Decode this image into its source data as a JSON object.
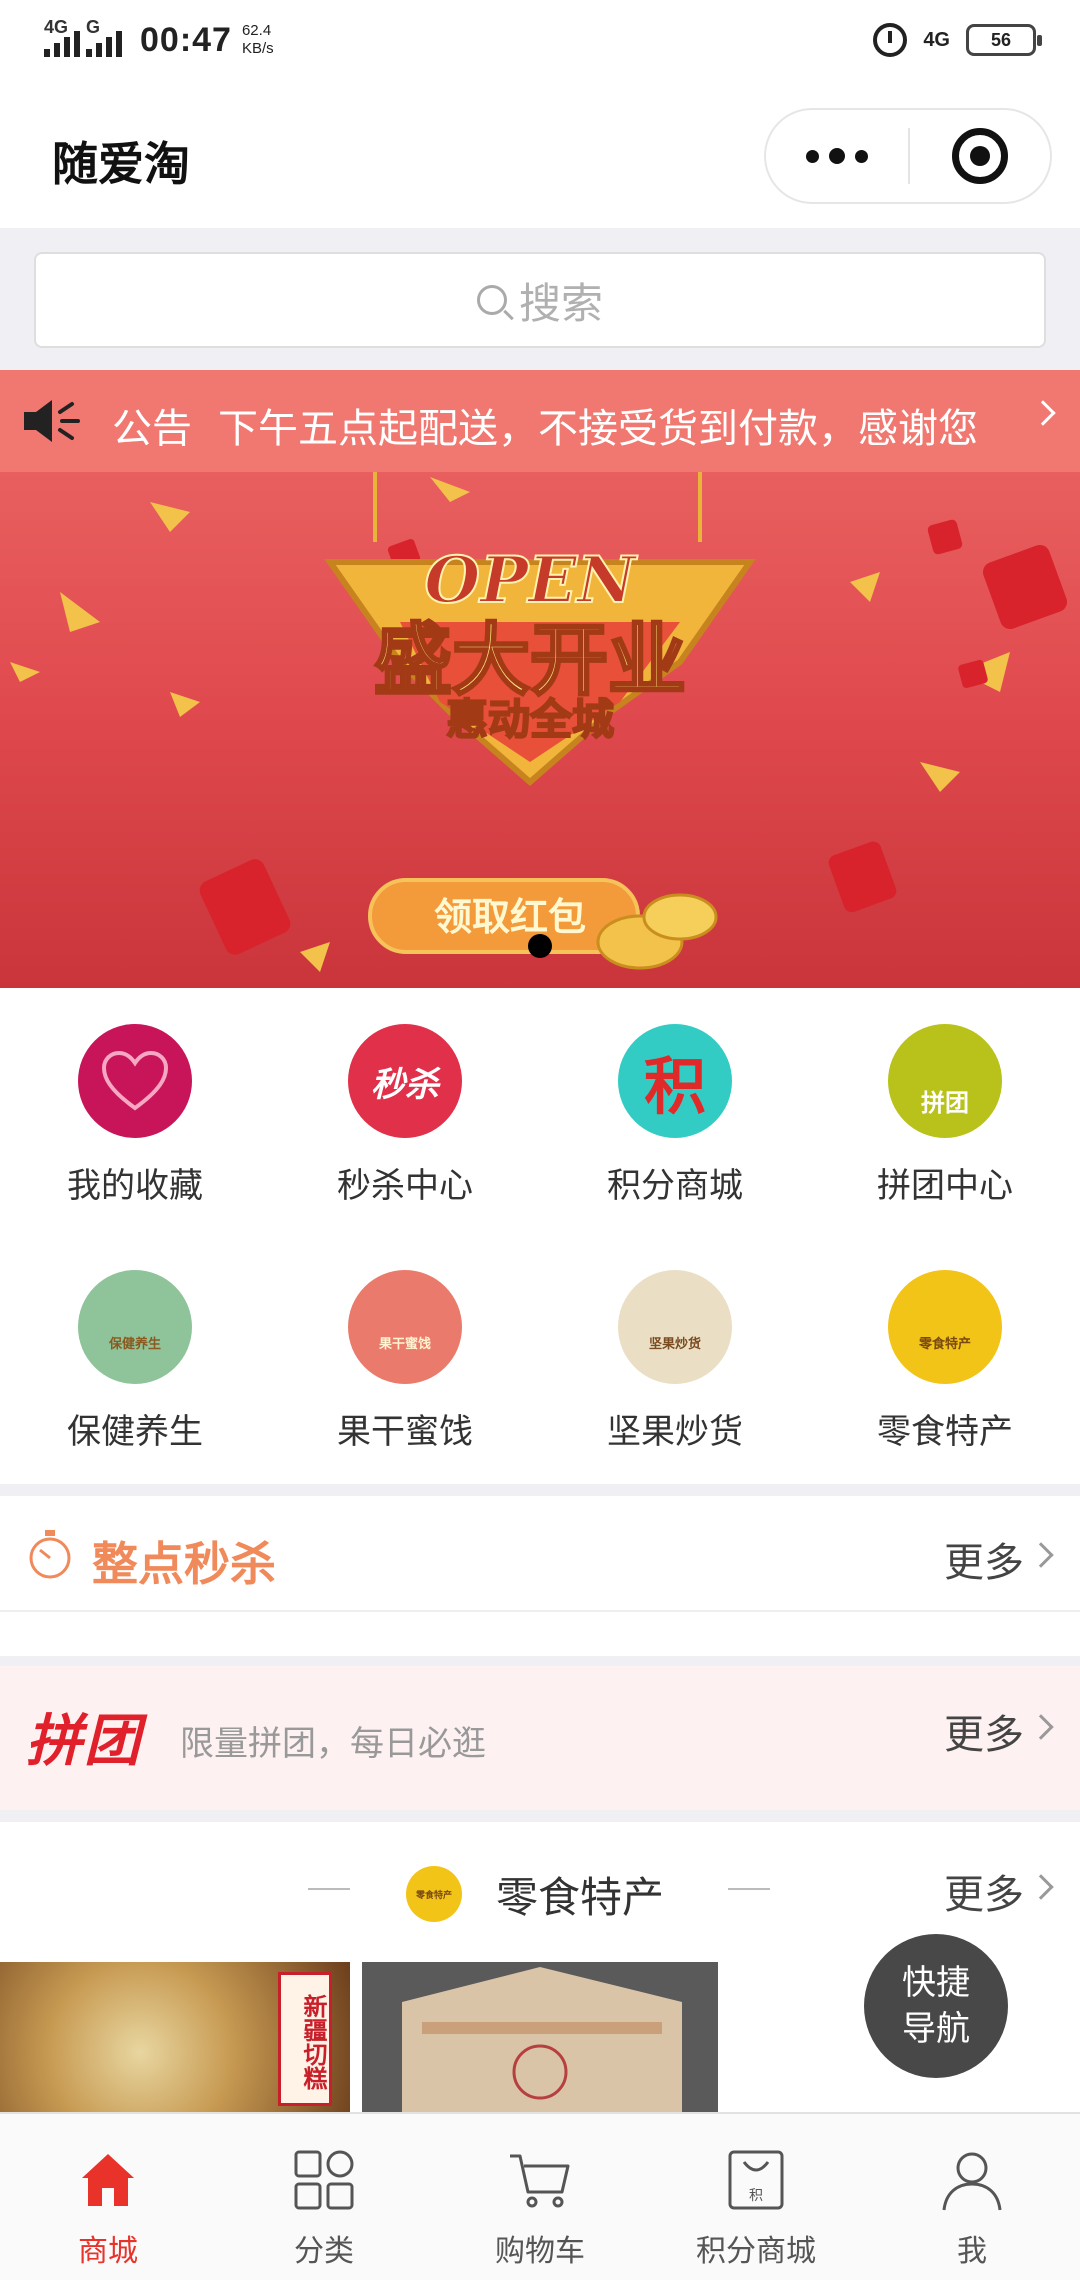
{
  "status_bar": {
    "net_left_1": "4G",
    "net_left_2": "G",
    "time": "00:47",
    "speed_value": "62.4",
    "speed_unit": "KB/s",
    "net_right": "4G",
    "battery": "56"
  },
  "header": {
    "title": "随爱淘"
  },
  "search": {
    "placeholder": "搜索"
  },
  "notice": {
    "label": "公告",
    "text": "下午五点起配送，不接受货到付款，感谢您"
  },
  "banner": {
    "headline": "OPEN",
    "title": "盛大开业",
    "subtitle": "惠动全城",
    "button": "领取红包",
    "slide_count": 1,
    "active_slide": 0
  },
  "grid": {
    "items": [
      {
        "label": "我的收藏",
        "icon": "heart-icon",
        "color": "#c8155a",
        "glyph": "♡"
      },
      {
        "label": "秒杀中心",
        "icon": "flash-sale-icon",
        "color": "#e0304a",
        "glyph": "秒杀"
      },
      {
        "label": "积分商城",
        "icon": "points-icon",
        "color": "#33ccc4",
        "glyph": "积"
      },
      {
        "label": "拼团中心",
        "icon": "group-buy-icon",
        "color": "#b8c21a",
        "glyph": "拼团"
      },
      {
        "label": "保健养生",
        "icon": "health-icon",
        "color": "#8fc49a",
        "glyph": "保健养生"
      },
      {
        "label": "果干蜜饯",
        "icon": "dried-fruit-icon",
        "color": "#ea7b6c",
        "glyph": "果干蜜饯"
      },
      {
        "label": "坚果炒货",
        "icon": "nuts-icon",
        "color": "#eadfc4",
        "glyph": "坚果炒货"
      },
      {
        "label": "零食特产",
        "icon": "snacks-icon",
        "color": "#f2c418",
        "glyph": "零食特产"
      }
    ]
  },
  "flash_sale": {
    "title": "整点秒杀",
    "more": "更多"
  },
  "group_buy": {
    "logo": "拼团",
    "tagline": "限量拼团，每日必逛",
    "more": "更多"
  },
  "snacks": {
    "title": "零食特产",
    "icon_text": "零食特产",
    "more": "更多",
    "product_1_tag": "新疆切糕"
  },
  "fab": {
    "line1": "快捷",
    "line2": "导航"
  },
  "tabbar": {
    "items": [
      {
        "label": "商城",
        "icon": "home-icon",
        "active": true
      },
      {
        "label": "分类",
        "icon": "category-icon",
        "active": false
      },
      {
        "label": "购物车",
        "icon": "cart-icon",
        "active": false
      },
      {
        "label": "积分商城",
        "icon": "points-bag-icon",
        "active": false
      },
      {
        "label": "我",
        "icon": "user-icon",
        "active": false
      }
    ]
  },
  "colors": {
    "accent": "#e8322a",
    "notice_bg": "#f07870",
    "flash_title": "#f08a5a",
    "page_bg": "#efeff4"
  }
}
